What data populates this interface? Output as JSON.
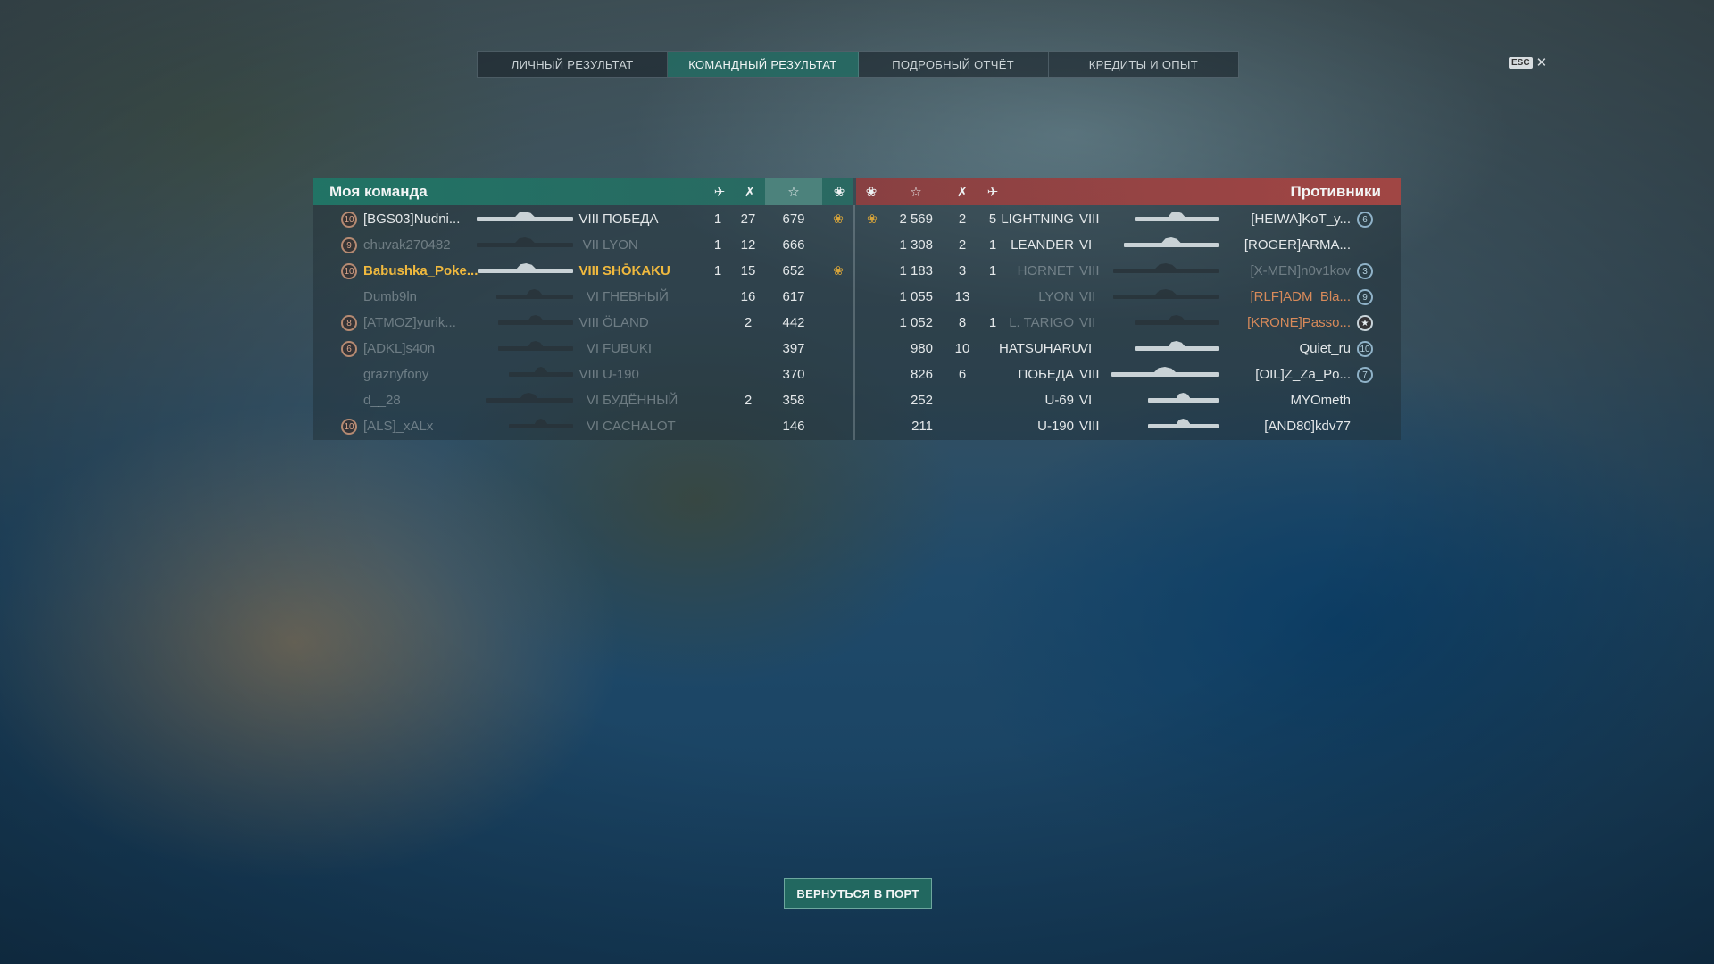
{
  "tabs": [
    {
      "label": "ЛИЧНЫЙ РЕЗУЛЬТАТ"
    },
    {
      "label": "КОМАНДНЫЙ РЕЗУЛЬТАТ"
    },
    {
      "label": "ПОДРОБНЫЙ ОТЧЁТ"
    },
    {
      "label": "КРЕДИТЫ И ОПЫТ"
    }
  ],
  "active_tab": "КОМАНДНЫЙ РЕЗУЛЬТАТ",
  "esc": {
    "key": "ESC",
    "close": "✕"
  },
  "my_team": {
    "title": "Моя команда",
    "rows": [
      {
        "badge": "10",
        "player": "[BGS03]Nudni...",
        "tier": "VIII",
        "ship": "ПОБЕДА",
        "planes": "1",
        "kills": "27",
        "xp": "679",
        "laurel": true,
        "dim": false,
        "hl": false,
        "ship_length": 0.9
      },
      {
        "badge": "9",
        "player": "chuvak270482",
        "tier": "VII",
        "ship": "LYON",
        "planes": "1",
        "kills": "12",
        "xp": "666",
        "laurel": false,
        "dim": true,
        "hl": false,
        "ship_length": 0.9
      },
      {
        "badge": "10",
        "player": "Babushka_Poke...",
        "tier": "VIII",
        "ship": "SHŌKAKU",
        "planes": "1",
        "kills": "15",
        "xp": "652",
        "laurel": true,
        "dim": false,
        "hl": true,
        "ship_length": 0.88
      },
      {
        "badge": "",
        "player": "Dumb9ln",
        "tier": "VI",
        "ship": "ГНЕВНЫЙ",
        "planes": "",
        "kills": "16",
        "xp": "617",
        "laurel": false,
        "dim": true,
        "hl": false,
        "ship_length": 0.72
      },
      {
        "badge": "8",
        "player": "[ATMOZ]yurik...",
        "tier": "VIII",
        "ship": "ÖLAND",
        "planes": "",
        "kills": "2",
        "xp": "442",
        "laurel": false,
        "dim": true,
        "hl": false,
        "ship_length": 0.7
      },
      {
        "badge": "6",
        "player": "[ADKL]s40n",
        "tier": "VI",
        "ship": "FUBUKI",
        "planes": "",
        "kills": "",
        "xp": "397",
        "laurel": false,
        "dim": true,
        "hl": false,
        "ship_length": 0.7
      },
      {
        "badge": "",
        "player": "graznyfony",
        "tier": "VIII",
        "ship": "U-190",
        "planes": "",
        "kills": "",
        "xp": "370",
        "laurel": false,
        "dim": true,
        "hl": false,
        "ship_length": 0.6
      },
      {
        "badge": "",
        "player": "d__28",
        "tier": "VI",
        "ship": "БУДЁННЫЙ",
        "planes": "",
        "kills": "2",
        "xp": "358",
        "laurel": false,
        "dim": true,
        "hl": false,
        "ship_length": 0.82
      },
      {
        "badge": "10",
        "player": "[ALS]_xALx",
        "tier": "VI",
        "ship": "CACHALOT",
        "planes": "",
        "kills": "",
        "xp": "146",
        "laurel": false,
        "dim": true,
        "hl": false,
        "ship_length": 0.6
      }
    ]
  },
  "enemy_team": {
    "title": "Противники",
    "rows": [
      {
        "laurel": true,
        "xp": "2 569",
        "kills": "2",
        "planes": "5",
        "ship": "LIGHTNING",
        "tier": "VIII",
        "player": "[HEIWA]KoT_y...",
        "badge": "6",
        "dim": false,
        "ship_length": 0.78,
        "clan_orange": false,
        "star": false
      },
      {
        "laurel": false,
        "xp": "1 308",
        "kills": "2",
        "planes": "1",
        "ship": "LEANDER",
        "tier": "VI",
        "player": "[ROGER]ARMA...",
        "badge": "",
        "dim": false,
        "ship_length": 0.88,
        "clan_orange": false,
        "star": false
      },
      {
        "laurel": false,
        "xp": "1 183",
        "kills": "3",
        "planes": "1",
        "ship": "HORNET",
        "tier": "VIII",
        "player": "[X-MEN]n0v1kov",
        "badge": "3",
        "dim": true,
        "ship_length": 0.98,
        "clan_orange": false,
        "star": false
      },
      {
        "laurel": false,
        "xp": "1 055",
        "kills": "13",
        "planes": "",
        "ship": "LYON",
        "tier": "VII",
        "player": "[RLF]ADM_Bla...",
        "badge": "9",
        "dim": true,
        "ship_length": 0.98,
        "clan_orange": true,
        "star": false
      },
      {
        "laurel": false,
        "xp": "1 052",
        "kills": "8",
        "planes": "1",
        "ship": "L. TARIGO",
        "tier": "VII",
        "player": "[KRONE]Passo...",
        "badge": "",
        "dim": true,
        "ship_length": 0.78,
        "clan_orange": true,
        "star": true
      },
      {
        "laurel": false,
        "xp": "980",
        "kills": "10",
        "planes": "",
        "ship": "HATSUHARU",
        "tier": "VI",
        "player": "Quiet_ru",
        "badge": "10",
        "dim": false,
        "ship_length": 0.78,
        "clan_orange": false,
        "star": false
      },
      {
        "laurel": false,
        "xp": "826",
        "kills": "6",
        "planes": "",
        "ship": "ПОБЕДА",
        "tier": "VIII",
        "player": "[OIL]Z_Za_Po...",
        "badge": "7",
        "dim": false,
        "ship_length": 1.0,
        "clan_orange": false,
        "star": false
      },
      {
        "laurel": false,
        "xp": "252",
        "kills": "",
        "planes": "",
        "ship": "U-69",
        "tier": "VI",
        "player": "MYOmeth",
        "badge": "",
        "dim": false,
        "ship_length": 0.66,
        "clan_orange": false,
        "star": false
      },
      {
        "laurel": false,
        "xp": "211",
        "kills": "",
        "planes": "",
        "ship": "U-190",
        "tier": "VIII",
        "player": "[AND80]kdv77",
        "badge": "",
        "dim": false,
        "ship_length": 0.66,
        "clan_orange": false,
        "star": false
      }
    ]
  },
  "header_icons": {
    "planes": "plane-icon",
    "kills": "kills-icon",
    "xp": "star-icon",
    "laurel": "laurel-icon"
  },
  "colors": {
    "ally": "#20786a",
    "enemy": "#aa4644",
    "highlight": "#f0b93e",
    "dim_text": "#bec8cc"
  },
  "return_button": "ВЕРНУТЬСЯ В ПОРТ"
}
